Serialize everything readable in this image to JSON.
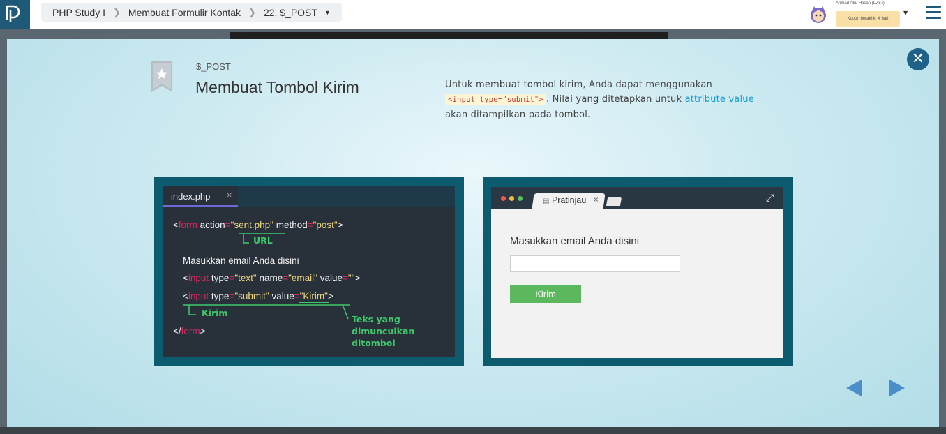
{
  "topbar": {
    "breadcrumb": [
      "PHP Study I",
      "Membuat Formulir Kontak",
      "22. $_POST"
    ],
    "user_name": "Ahmad Abu Hasan (Lv.87)",
    "coupon": "Kupon berakhir: 4 hari"
  },
  "slide": {
    "tag": "$_POST",
    "title": "Membuat Tombol Kirim",
    "desc_1": "Untuk membuat tombol kirim, Anda dapat menggunakan",
    "desc_code": "<input type=\"submit\">",
    "desc_2": ". Nilai yang ditetapkan untuk",
    "desc_link": "attribute value",
    "desc_3": "akan ditampilkan pada tombol."
  },
  "editor": {
    "filename": "index.php",
    "close": "×",
    "line1": {
      "lt": "<",
      "tag": "form",
      "a1": " action",
      "eq1": "=",
      "v1": "\"sent.php\"",
      "a2": " method",
      "eq2": "=",
      "v2": "\"post\"",
      "gt": ">"
    },
    "line2": "Masukkan email Anda disini",
    "line3": {
      "lt": "<",
      "tag": "input",
      "a1": " type",
      "eq1": "=",
      "v1": "\"text\"",
      "a2": " name",
      "eq2": "=",
      "v2": "\"email\"",
      "a3": " value",
      "eq3": "=",
      "v3": "\"\"",
      "gt": ">"
    },
    "line4": {
      "lt": "<",
      "tag": "input",
      "a1": " type",
      "eq1": "=",
      "v1": "\"submit\"",
      "a2": " value",
      "eq2": "=",
      "v2": "\"Kirim\"",
      "gt": ">"
    },
    "line5": {
      "lt": "</",
      "tag": "form",
      "gt": ">"
    },
    "anno_url": "URL",
    "anno_kirim": "Kirim",
    "anno_text": [
      "Teks yang",
      "dimunculkan",
      "ditombol"
    ]
  },
  "preview": {
    "tab_label": "Pratinjau",
    "tab_close": "×",
    "label": "Masukkan email Anda disini",
    "input_value": "",
    "button_label": "Kirim"
  },
  "colors": {
    "modal_close": "#1e6287",
    "panel_bg": "#0d5b6e",
    "submit_green": "#5cb85c",
    "annotation_green": "#3ec86c",
    "nav_arrow": "#4a8fc9"
  },
  "icons": {
    "logo": "progate-logo",
    "close": "close-icon",
    "bookmark": "bookmark-star-icon",
    "menu": "hamburger-menu-icon",
    "expand": "expand-icon",
    "prev": "prev-arrow-icon",
    "next": "next-arrow-icon"
  }
}
